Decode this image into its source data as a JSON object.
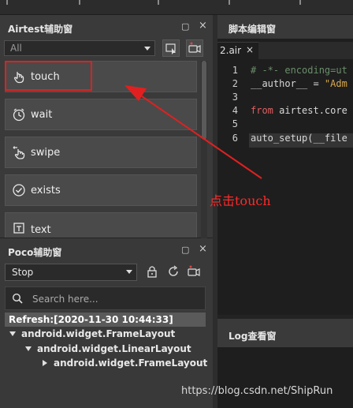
{
  "airtest_panel": {
    "title": "Airtest辅助窗",
    "device_select": "All",
    "items": [
      {
        "label": "touch",
        "icon": "touch-hand-icon"
      },
      {
        "label": "wait",
        "icon": "clock-icon"
      },
      {
        "label": "swipe",
        "icon": "swipe-hand-icon"
      },
      {
        "label": "exists",
        "icon": "check-circle-icon"
      },
      {
        "label": "text",
        "icon": "text-icon"
      }
    ]
  },
  "poco_panel": {
    "title": "Poco辅助窗",
    "mode_select": "Stop",
    "search_placeholder": "Search here...",
    "refresh_label": "Refresh:[2020-11-30 10:44:33]",
    "tree": [
      {
        "label": "android.widget.FrameLayout",
        "expanded": true,
        "depth": 0
      },
      {
        "label": "android.widget.LinearLayout",
        "expanded": true,
        "depth": 1
      },
      {
        "label": "android.widget.FrameLayout",
        "expanded": false,
        "depth": 2
      }
    ]
  },
  "editor": {
    "title": "脚本编辑窗",
    "tab_name": "2.air",
    "tab_close": "×",
    "line_numbers": [
      "1",
      "2",
      "3",
      "4",
      "5",
      "6"
    ],
    "lines": {
      "l1": "# -*- encoding=ut",
      "l2_a": "__author__ = ",
      "l2_b": "\"Adm",
      "l4_kw": "from",
      "l4_rest": " airtest.core",
      "l6": "auto_setup(__file"
    }
  },
  "log_panel": {
    "title": "Log查看窗"
  },
  "annotation": {
    "text": "点击touch",
    "color": "#ff2a2a"
  },
  "watermark": "https://blog.csdn.net/ShipRun",
  "window_controls": {
    "restore": "▢",
    "close": "×"
  }
}
